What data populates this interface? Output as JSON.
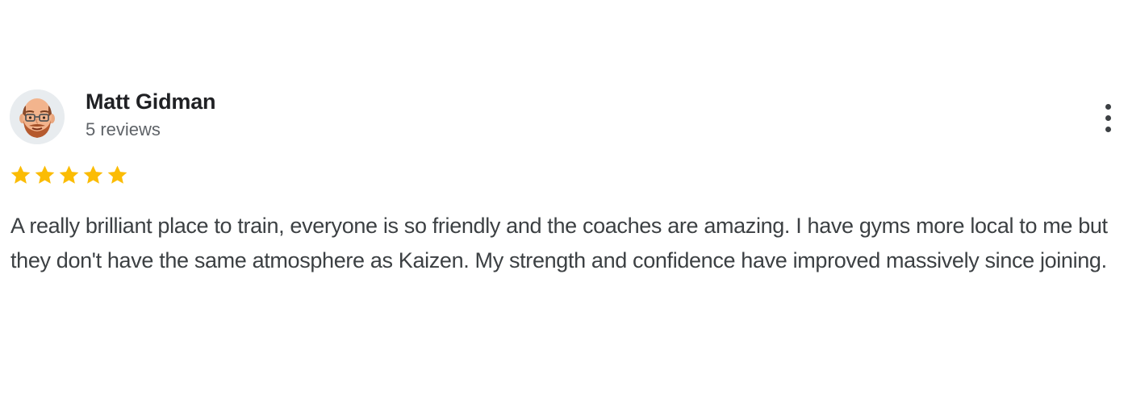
{
  "review": {
    "author": "Matt Gidman",
    "review_count": "5 reviews",
    "rating": 5,
    "rating_max": 5,
    "text": "A really brilliant place to train, everyone is so friendly and the coaches are amazing. I have gyms more local to me but they don't have the same atmosphere as Kaizen. My strength and confidence have improved massively since joining."
  },
  "icons": {
    "avatar": "bald-man-with-glasses-and-beard-avatar",
    "star": "star-icon",
    "more": "more-vertical-icon"
  },
  "colors": {
    "star": "#fbbc04",
    "name": "#202124",
    "secondary_text": "#5f6368",
    "body_text": "#3c4043"
  }
}
